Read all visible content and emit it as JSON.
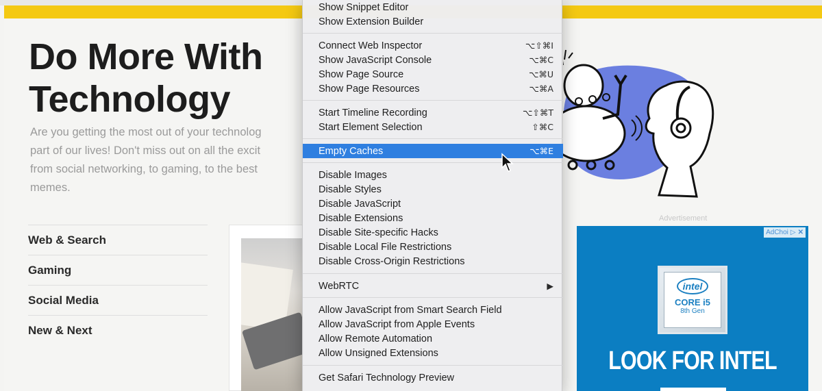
{
  "page": {
    "hero_title_line1": "Do More With",
    "hero_title_line2": "Technology",
    "hero_body_lines": [
      "Are you getting the most out of your technolog",
      "part of our lives! Don't miss out on all the excit",
      "from social networking, to gaming, to the best",
      "memes."
    ],
    "nav_items": [
      "Web & Search",
      "Gaming",
      "Social Media",
      "New & Next"
    ],
    "ad": {
      "label": "Advertisement",
      "adchoices": "AdChoi",
      "intel_logo": "intel",
      "intel_core": "CORE i5",
      "intel_gen": "8th Gen",
      "headline": "LOOK FOR INTEL",
      "background_color": "#0b7ec2"
    },
    "accent_color": "#f4c913"
  },
  "menu": {
    "items": [
      {
        "label": "Show Snippet Editor",
        "shortcut": ""
      },
      {
        "label": "Show Extension Builder",
        "shortcut": ""
      },
      {
        "label": "Connect Web Inspector",
        "shortcut": "⌥⇧⌘I"
      },
      {
        "label": "Show JavaScript Console",
        "shortcut": "⌥⌘C"
      },
      {
        "label": "Show Page Source",
        "shortcut": "⌥⌘U"
      },
      {
        "label": "Show Page Resources",
        "shortcut": "⌥⌘A"
      },
      {
        "label": "Start Timeline Recording",
        "shortcut": "⌥⇧⌘T"
      },
      {
        "label": "Start Element Selection",
        "shortcut": "⇧⌘C"
      },
      {
        "label": "Empty Caches",
        "shortcut": "⌥⌘E",
        "highlighted": true
      },
      {
        "label": "Disable Images",
        "shortcut": ""
      },
      {
        "label": "Disable Styles",
        "shortcut": ""
      },
      {
        "label": "Disable JavaScript",
        "shortcut": ""
      },
      {
        "label": "Disable Extensions",
        "shortcut": ""
      },
      {
        "label": "Disable Site-specific Hacks",
        "shortcut": ""
      },
      {
        "label": "Disable Local File Restrictions",
        "shortcut": ""
      },
      {
        "label": "Disable Cross-Origin Restrictions",
        "shortcut": ""
      },
      {
        "label": "WebRTC",
        "shortcut": "▶",
        "submenu": true
      },
      {
        "label": "Allow JavaScript from Smart Search Field",
        "shortcut": ""
      },
      {
        "label": "Allow JavaScript from Apple Events",
        "shortcut": ""
      },
      {
        "label": "Allow Remote Automation",
        "shortcut": ""
      },
      {
        "label": "Allow Unsigned Extensions",
        "shortcut": ""
      },
      {
        "label": "Get Safari Technology Preview",
        "shortcut": ""
      }
    ],
    "highlight_color": "#2f7fe0"
  }
}
